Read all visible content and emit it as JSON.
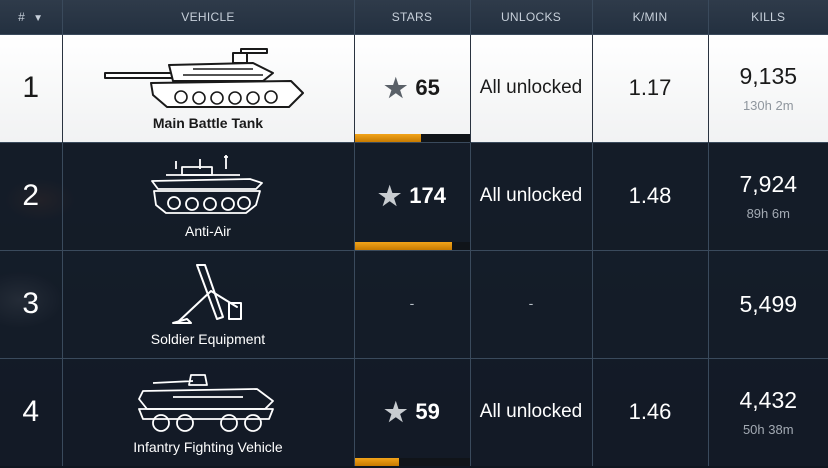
{
  "headers": {
    "rank": "#",
    "vehicle": "VEHICLE",
    "stars": "STARS",
    "unlocks": "UNLOCKS",
    "kpm": "K/MIN",
    "kills": "KILLS"
  },
  "rows": [
    {
      "rank": "1",
      "vehicle": "Main Battle Tank",
      "icon": "tank-icon",
      "stars": "65",
      "progress": 0.58,
      "unlocks": "All unlocked",
      "kpm": "1.17",
      "kills": "9,135",
      "time": "130h 2m"
    },
    {
      "rank": "2",
      "vehicle": "Anti-Air",
      "icon": "anti-air-icon",
      "stars": "174",
      "progress": 0.85,
      "unlocks": "All unlocked",
      "kpm": "1.48",
      "kills": "7,924",
      "time": "89h 6m"
    },
    {
      "rank": "3",
      "vehicle": "Soldier Equipment",
      "icon": "mortar-icon",
      "stars": "-",
      "progress": null,
      "unlocks": "-",
      "kpm": "",
      "kills": "5,499",
      "time": ""
    },
    {
      "rank": "4",
      "vehicle": "Infantry Fighting Vehicle",
      "icon": "ifv-icon",
      "stars": "59",
      "progress": 0.39,
      "unlocks": "All unlocked",
      "kpm": "1.46",
      "kills": "4,432",
      "time": "50h 38m"
    }
  ],
  "colors": {
    "progress": "#f2a41a",
    "selected_row": "#ffffff"
  }
}
